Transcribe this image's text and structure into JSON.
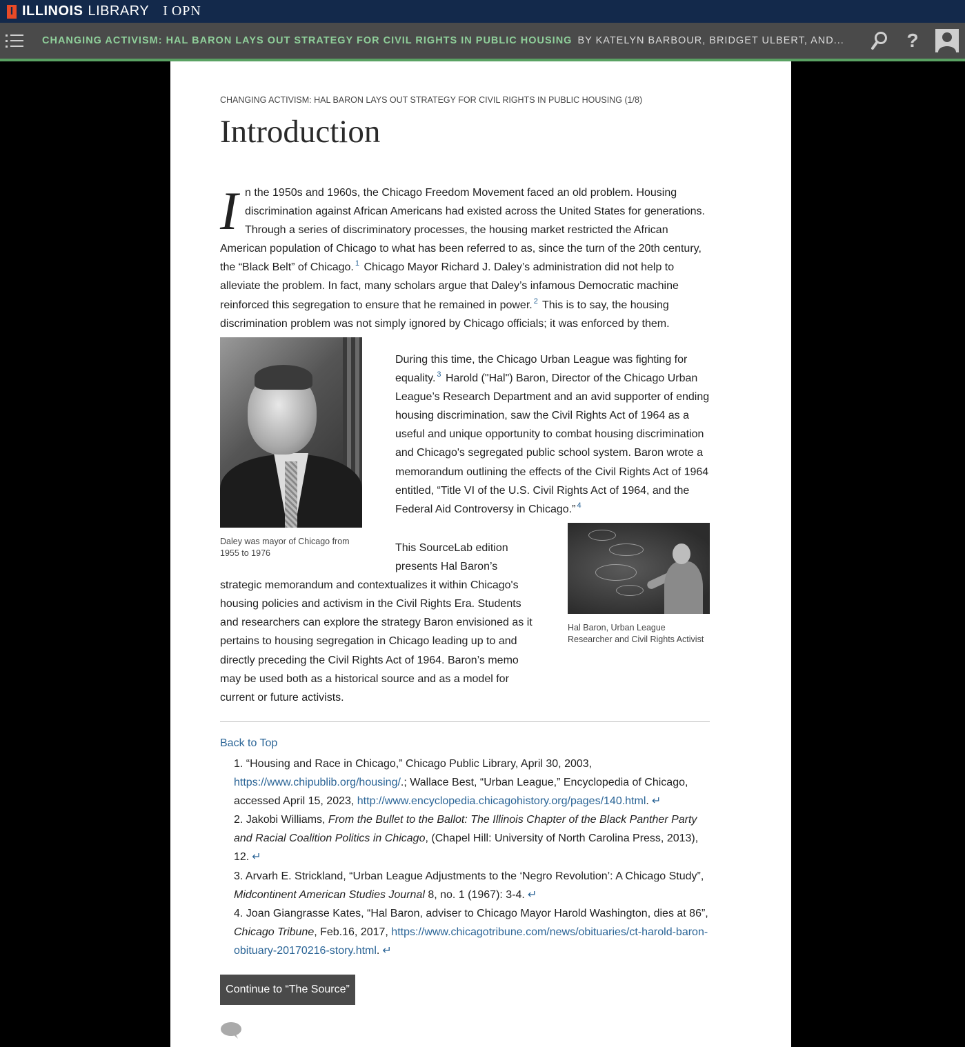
{
  "brand": {
    "mark": "I",
    "name": "ILLINOIS",
    "library": "LIBRARY",
    "iopn": "I OPN"
  },
  "header": {
    "title": "Changing Activism: Hal Baron Lays Out Strategy for Civil Rights in Public Housing",
    "authors": "BY KATELYN BARBOUR, BRIDGET ULBERT, AND...",
    "help_label": "?"
  },
  "article": {
    "kicker": "CHANGING ACTIVISM: HAL BARON LAYS OUT STRATEGY FOR CIVIL RIGHTS IN PUBLIC HOUSING (1/8)",
    "heading": "Introduction",
    "dropcap": "I",
    "para1_a": "n the 1950s and 1960s, the Chicago Freedom Movement faced an old problem. Housing discrimination against African Americans had existed across the United States for generations. Through a series of discriminatory processes, the housing market restricted the African American population of Chicago to what has been referred to as, since the turn of the 20th century, the “Black Belt” of Chicago.",
    "fn1": "1",
    "para1_b": " Chicago Mayor Richard J. Daley’s administration did not help to alleviate the problem. In fact, many scholars argue that Daley’s infamous Democratic machine reinforced this segregation to ensure that he remained in power.",
    "fn2": "2",
    "para1_c": " This is to say, the housing discrimination problem was not simply ignored by Chicago officials; it was enforced by them.",
    "fig1_caption": "Daley was mayor of Chicago from 1955 to 1976",
    "para2_a": "During this time, the Chicago Urban League was fighting for equality.",
    "fn3": "3",
    "para2_b": " Harold (\"Hal\") Baron, Director of the Chicago Urban League’s Research Department and an avid supporter of ending housing discrimination, saw the Civil Rights Act of 1964 as a useful and unique opportunity to combat housing discrimination and Chicago's segregated public school system. Baron wrote a memorandum outlining the effects of the Civil Rights Act of 1964 entitled, “Title VI of the U.S. Civil Rights Act of 1964, and the Federal Aid Controversy in Chicago.”",
    "fn4": "4",
    "fig2_caption": "Hal Baron, Urban League Researcher and Civil Rights Activist",
    "para3": "This SourceLab edition presents Hal Baron’s strategic memorandum and contextualizes it within Chicago's housing policies and activism in the Civil Rights Era. Students and researchers can explore the strategy Baron envisioned as it pertains to housing segregation in Chicago leading up to and directly preceding the Civil Rights Act of 1964. Baron’s memo may be used both as a historical source and as a model for current or future activists."
  },
  "footnotes": {
    "back_to_top": "Back to Top",
    "return_symbol": "↵",
    "n1_a": "1. “Housing and Race in Chicago,” Chicago Public Library, April 30, 2003, ",
    "n1_link1": "https://www.chipublib.org/housing/",
    "n1_b": ".; Wallace Best, “Urban League,” Encyclopedia of Chicago, accessed April 15, 2023, ",
    "n1_link2": "http://www.encyclopedia.chicagohistory.org/pages/140.html",
    "n1_c": ".",
    "n2_a": "2. Jakobi Williams, ",
    "n2_title": "From the Bullet to the Ballot: The Illinois Chapter of the Black Panther Party and Racial Coalition Politics in Chicago",
    "n2_b": ", (Chapel Hill: University of North Carolina Press, 2013), 12.",
    "n3_a": "3. Arvarh E. Strickland, “Urban League Adjustments to the ‘Negro Revolution’: A Chicago Study”, ",
    "n3_title": "Midcontinent American Studies Journal",
    "n3_b": " 8, no. 1 (1967): 3-4.",
    "n4_a": "4. Joan Giangrasse Kates, “Hal Baron, adviser to Chicago Mayor Harold Washington, dies at 86”, ",
    "n4_title": "Chicago Tribune",
    "n4_b": ", Feb.16, 2017, ",
    "n4_link": "https://www.chicagotribune.com/news/obituaries/ct-harold-baron-obituary-20170216-story.html",
    "n4_c": "."
  },
  "continue_button": "Continue to “The Source”",
  "colors": {
    "brand_navy": "#13294b",
    "brand_orange": "#e84a27",
    "header_gray": "#4a4a4a",
    "title_green": "#8fcf9a",
    "accent_line": "#5aa263",
    "link_blue": "#2a6496"
  },
  "icons": {
    "menu": "menu-icon",
    "search": "search-icon",
    "help": "help-icon",
    "user": "user-icon",
    "comment": "comment-icon",
    "return": "return-arrow-icon"
  }
}
